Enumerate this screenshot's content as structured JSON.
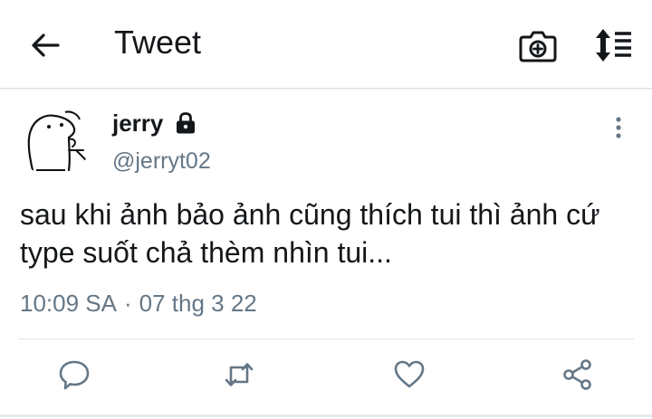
{
  "header": {
    "title": "Tweet",
    "back_icon": "arrow-left-icon",
    "camera_icon": "camera-plus-icon",
    "sort_icon": "sort-list-icon"
  },
  "tweet": {
    "display_name": "jerry",
    "handle": "@jerryt02",
    "protected_icon": "lock-icon",
    "text": "sau khi ảnh bảo ảnh cũng thích tui thì ảnh cứ type suốt chả thèm nhìn tui...",
    "time": "10:09 SA",
    "separator": "·",
    "date": "07 thg 3 22"
  },
  "actions": [
    "reply-icon",
    "retweet-icon",
    "like-icon",
    "share-icon"
  ],
  "colors": {
    "text": "#14171a",
    "secondary": "#657786",
    "action_icon": "#657786",
    "divider": "#e1e6ea"
  }
}
